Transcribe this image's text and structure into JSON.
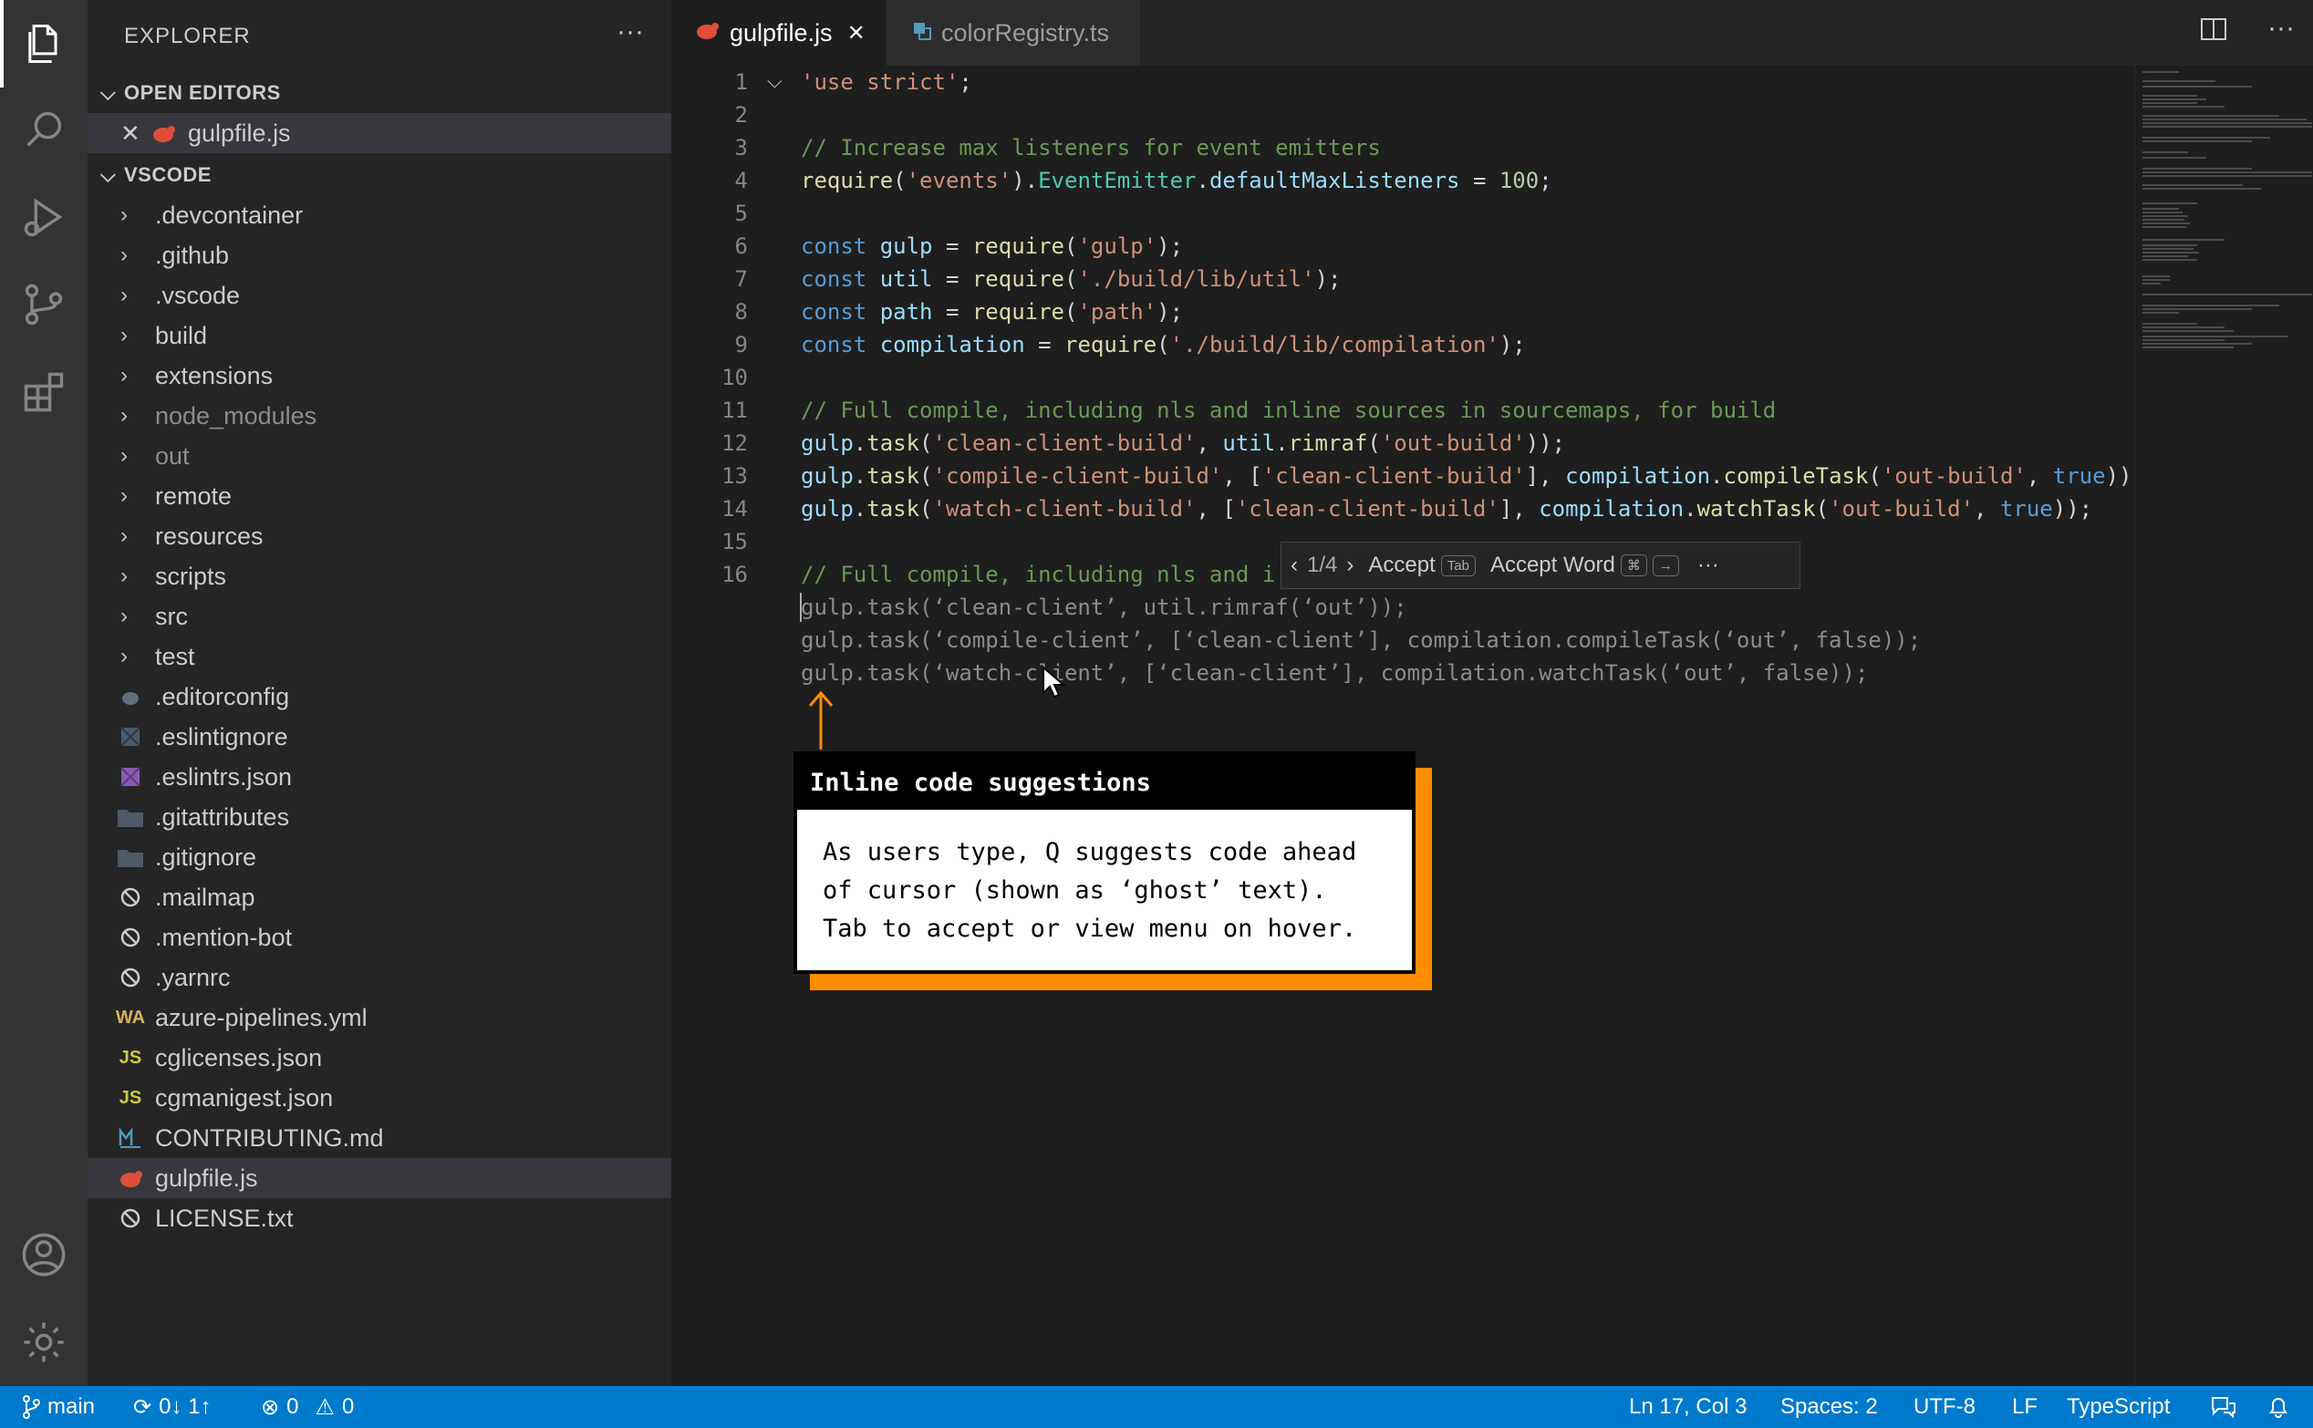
{
  "sidebar": {
    "title": "EXPLORER",
    "more_label": "···",
    "open_editors_label": "OPEN EDITORS",
    "open_editor_file": "gulpfile.js",
    "workspace_label": "VSCODE",
    "folders": [
      ".devcontainer",
      ".github",
      ".vscode",
      "build",
      "extensions",
      "node_modules",
      "out",
      "remote",
      "resources",
      "scripts",
      "src",
      "test"
    ],
    "files": [
      ".editorconfig",
      ".eslintignore",
      ".eslintrs.json",
      ".gitattributes",
      ".gitignore",
      ".mailmap",
      ".mention-bot",
      ".yarnrc",
      "azure-pipelines.yml",
      "cglicenses.json",
      "cgmanigest.json",
      "CONTRIBUTING.md",
      "gulpfile.js",
      "LICENSE.txt"
    ],
    "file_badges": {
      "azure": "WA",
      "json1": "JS",
      "json2": "JS"
    }
  },
  "tabs": [
    {
      "label": "gulpfile.js",
      "close": "✕"
    },
    {
      "label": "colorRegistry.ts"
    }
  ],
  "editor": {
    "line_numbers": [
      "1",
      "2",
      "3",
      "4",
      "5",
      "6",
      "7",
      "8",
      "9",
      "10",
      "11",
      "12",
      "13",
      "14",
      "15",
      "16"
    ],
    "ghost_lines": [
      "gulp.task(‘clean-client’, util.rimraf(‘out’));",
      "gulp.task(‘compile-client’, [‘clean-client’], compilation.compileTask(‘out’, false));",
      "gulp.task(‘watch-client’, [‘clean-client’], compilation.watchTask(‘out’, false));"
    ]
  },
  "inline_suggest": {
    "counter": "1/4",
    "accept": "Accept",
    "accept_key": "Tab",
    "accept_word": "Accept Word",
    "word_key1": "⌘",
    "word_key2": "→",
    "more": "···"
  },
  "callout": {
    "title": "Inline code suggestions",
    "body": "As users type, Q suggests code ahead\nof cursor (shown as ‘ghost’ text).\nTab to accept or view menu on hover."
  },
  "status": {
    "branch": "main",
    "sync": "0↓ 1↑",
    "errors": "0",
    "warnings": "0",
    "position": "Ln 17, Col 3",
    "spaces": "Spaces: 2",
    "encoding": "UTF-8",
    "eol": "LF",
    "language": "TypeScript"
  },
  "colors": {
    "accent": "#007acc",
    "callout_shadow": "#ff8c00",
    "gulp_red": "#e04e39"
  }
}
